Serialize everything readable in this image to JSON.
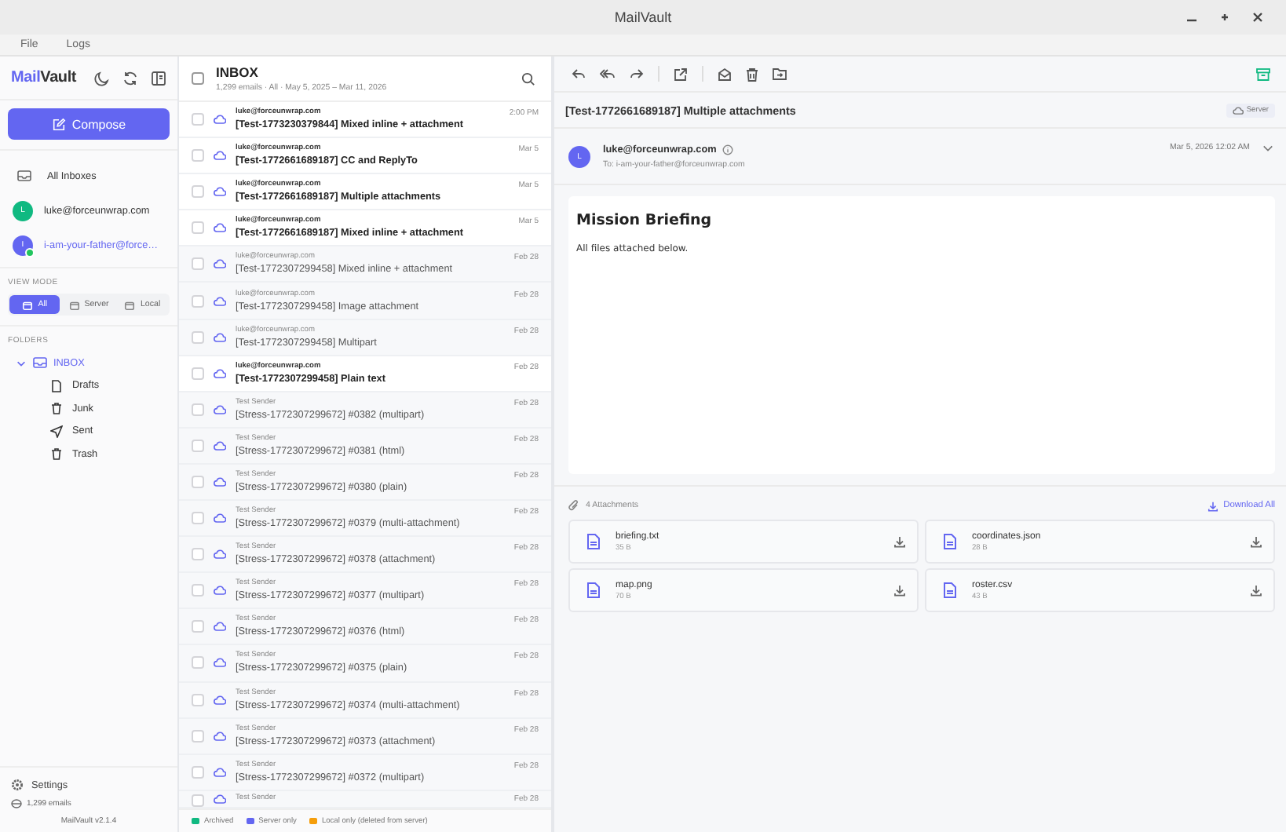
{
  "window": {
    "title": "MailVault"
  },
  "menu": [
    "File",
    "Logs"
  ],
  "sidebar": {
    "logo_accent": "Mail",
    "logo_rest": "Vault",
    "compose": "Compose",
    "all_inboxes": "All Inboxes",
    "accounts": [
      {
        "initial": "L",
        "email": "luke@forceunwrap.com",
        "color": "#10b981",
        "selected": false,
        "online": false
      },
      {
        "initial": "I",
        "email": "i-am-your-father@force…",
        "color": "#6366f1",
        "selected": true,
        "online": true
      }
    ],
    "view_mode_label": "VIEW MODE",
    "view_modes": [
      {
        "label": "All",
        "selected": true
      },
      {
        "label": "Server",
        "selected": false
      },
      {
        "label": "Local",
        "selected": false
      }
    ],
    "folders_label": "FOLDERS",
    "folders": [
      {
        "name": "INBOX",
        "expanded": true,
        "selected": true,
        "children": [
          {
            "name": "Drafts",
            "kind": "drafts"
          },
          {
            "name": "Junk",
            "kind": "junk"
          },
          {
            "name": "Sent",
            "kind": "sent"
          },
          {
            "name": "Trash",
            "kind": "trash"
          }
        ]
      }
    ],
    "settings": "Settings",
    "email_count": "1,299 emails",
    "version": "MailVault v2.1.4"
  },
  "list": {
    "select_all": {
      "checked": false
    },
    "title": "INBOX",
    "summary": "1,299 emails · All · May 5, 2025 – Mar 11, 2026",
    "rows": [
      {
        "sender": "luke@forceunwrap.com",
        "subject": "[Test-1773230379844] Mixed inline + attachment",
        "date": "2:00 PM",
        "unread": true
      },
      {
        "sender": "luke@forceunwrap.com",
        "subject": "[Test-1772661689187] CC and ReplyTo",
        "date": "Mar 5",
        "unread": true
      },
      {
        "sender": "luke@forceunwrap.com",
        "subject": "[Test-1772661689187] Multiple attachments",
        "date": "Mar 5",
        "unread": true
      },
      {
        "sender": "luke@forceunwrap.com",
        "subject": "[Test-1772661689187] Mixed inline + attachment",
        "date": "Mar 5",
        "unread": true
      },
      {
        "sender": "luke@forceunwrap.com",
        "subject": "[Test-1772307299458] Mixed inline + attachment",
        "date": "Feb 28",
        "unread": false
      },
      {
        "sender": "luke@forceunwrap.com",
        "subject": "[Test-1772307299458] Image attachment",
        "date": "Feb 28",
        "unread": false
      },
      {
        "sender": "luke@forceunwrap.com",
        "subject": "[Test-1772307299458] Multipart",
        "date": "Feb 28",
        "unread": false
      },
      {
        "sender": "luke@forceunwrap.com",
        "subject": "[Test-1772307299458] Plain text",
        "date": "Feb 28",
        "unread": true
      },
      {
        "sender": "Test Sender",
        "subject": "[Stress-1772307299672] #0382 (multipart)",
        "date": "Feb 28",
        "unread": false
      },
      {
        "sender": "Test Sender",
        "subject": "[Stress-1772307299672] #0381 (html)",
        "date": "Feb 28",
        "unread": false
      },
      {
        "sender": "Test Sender",
        "subject": "[Stress-1772307299672] #0380 (plain)",
        "date": "Feb 28",
        "unread": false
      },
      {
        "sender": "Test Sender",
        "subject": "[Stress-1772307299672] #0379 (multi-attachment)",
        "date": "Feb 28",
        "unread": false
      },
      {
        "sender": "Test Sender",
        "subject": "[Stress-1772307299672] #0378 (attachment)",
        "date": "Feb 28",
        "unread": false
      },
      {
        "sender": "Test Sender",
        "subject": "[Stress-1772307299672] #0377 (multipart)",
        "date": "Feb 28",
        "unread": false
      },
      {
        "sender": "Test Sender",
        "subject": "[Stress-1772307299672] #0376 (html)",
        "date": "Feb 28",
        "unread": false
      },
      {
        "sender": "Test Sender",
        "subject": "[Stress-1772307299672] #0375 (plain)",
        "date": "Feb 28",
        "unread": false
      },
      {
        "sender": "Test Sender",
        "subject": "[Stress-1772307299672] #0374 (multi-attachment)",
        "date": "Feb 28",
        "unread": false
      },
      {
        "sender": "Test Sender",
        "subject": "[Stress-1772307299672] #0373 (attachment)",
        "date": "Feb 28",
        "unread": false
      },
      {
        "sender": "Test Sender",
        "subject": "[Stress-1772307299672] #0372 (multipart)",
        "date": "Feb 28",
        "unread": false
      },
      {
        "sender": "Test Sender",
        "date": "Feb 28",
        "unread": false
      }
    ],
    "legend": [
      {
        "label": "Archived",
        "color": "#10b981"
      },
      {
        "label": "Server only",
        "color": "#6366f1"
      },
      {
        "label": "Local only (deleted from server)",
        "color": "#f59e0b"
      }
    ]
  },
  "reader": {
    "subject": "[Test-1772661689187] Multiple attachments",
    "location": "Server",
    "from_initial": "L",
    "from": "luke@forceunwrap.com",
    "to": "To: i-am-your-father@forceunwrap.com",
    "date": "Mar 5, 2026 12:02 AM",
    "body_heading": "Mission Briefing",
    "body_text": "All files attached below.",
    "attachments_label": "4 Attachments",
    "download_all": "Download All",
    "attachments": [
      {
        "name": "briefing.txt",
        "size": "35 B"
      },
      {
        "name": "coordinates.json",
        "size": "28 B"
      },
      {
        "name": "map.png",
        "size": "70 B"
      },
      {
        "name": "roster.csv",
        "size": "43 B"
      }
    ]
  }
}
